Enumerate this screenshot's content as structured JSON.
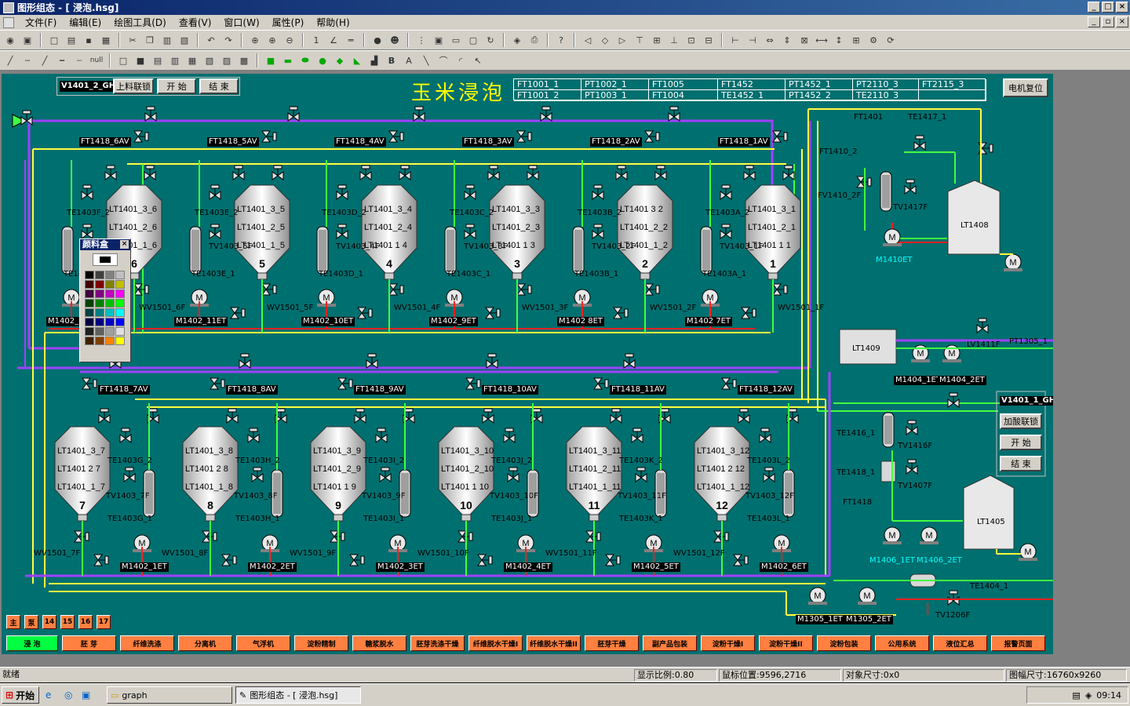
{
  "window": {
    "title": "图形组态 - [ 浸泡.hsg]"
  },
  "menu": [
    "文件(F)",
    "编辑(E)",
    "绘图工具(D)",
    "查看(V)",
    "窗口(W)",
    "属性(P)",
    "帮助(H)"
  ],
  "canvas": {
    "title": "玉米浸泡",
    "top_input": "V1401_2_GH",
    "top_buttons": [
      "上料联锁",
      "开 始",
      "结 束"
    ],
    "reset_button": "电机复位",
    "ft_table": [
      [
        "FT1001_1",
        "PT1002_1",
        "FT1005",
        "FT1452",
        "PT1452_1",
        "PT2110_3",
        "FT2115_3"
      ],
      [
        "FT1001_2",
        "PT1003_1",
        "FT1004",
        "TE1452_1",
        "PT1452_2",
        "TE2110_3",
        ""
      ]
    ],
    "tank_numbers_top": [
      "6",
      "5",
      "4",
      "3",
      "2",
      "1"
    ],
    "tank_numbers_bottom": [
      "7",
      "8",
      "9",
      "10",
      "11",
      "12"
    ],
    "tanks_top": [
      [
        "LT1401_3_6",
        "LT1401_2_6",
        "LT1401_1_6"
      ],
      [
        "LT1401_3_5",
        "LT1401_2_5",
        "LT1401_1_5"
      ],
      [
        "LT1401_3_4",
        "LT1401_2_4",
        "LT1401 1 4"
      ],
      [
        "LT1401_3_3",
        "LT1401_2_3",
        "LT1401 1 3"
      ],
      [
        "LT1401 3 2",
        "LT1401_2_2",
        "LT1401_1_2"
      ],
      [
        "LT1401_3_1",
        "LT1401_2_1",
        "LT1401 1 1"
      ]
    ],
    "tanks_bottom": [
      [
        "LT1401_3_7",
        "LT1401 2 7",
        "LT1401_1_7"
      ],
      [
        "LT1401_3_8",
        "LT1401 2 8",
        "LT1401_1_8"
      ],
      [
        "LT1401_3_9",
        "LT1401_2_9",
        "LT1401 1 9"
      ],
      [
        "LT1401_3_10",
        "LT1401_2_10",
        "LT1401 1 10"
      ],
      [
        "LT1401_3_11",
        "LT1401_2_11",
        "LT1401_1_11"
      ],
      [
        "LT1401_3_12",
        "LT1401 2 12",
        "LT1401_1_12"
      ]
    ],
    "ft_top": [
      "FT1418_6AV",
      "FT1418_5AV",
      "FT1418_4AV",
      "FT1418_3AV",
      "FT1418_2AV",
      "FT1418_1AV"
    ],
    "ft_bottom": [
      "FT1418_7AV",
      "FT1418_8AV",
      "FT1418_9AV",
      "FT1418_10AV",
      "FT1418_11AV",
      "FT1418_12AV"
    ],
    "te_top": [
      "TE1403F_2",
      "TE1403E_2",
      "TE1403D_2",
      "TE1403C_2",
      "TE1403B_2",
      "TE1403A_2"
    ],
    "te_top_low": [
      "TE1403F_1",
      "TE1403E_1",
      "TE1403D_1",
      "TE1403C_1",
      "TE1403B_1",
      "TE1403A_1"
    ],
    "tv_top": [
      "TV1403_6F",
      "TV1403_5F",
      "TV1403_4F",
      "TV1403_3F",
      "TV1403_2F",
      "TV1403_1F"
    ],
    "wv_top": [
      "WV1501_6F",
      "WV1501_5F",
      "WV1501_4F",
      "WV1501_3F",
      "WV1501_2F",
      "WV1501_1F"
    ],
    "m_top": [
      "M1402_12ET",
      "M1402_11ET",
      "M1402_10ET",
      "M1402_9ET",
      "M1402 8ET",
      "M1402 7ET"
    ],
    "te_bot": [
      "TE1403G_2",
      "TE1403H_2",
      "TE1403I_2",
      "TE1403J_2",
      "TE1403K_2",
      "TE1403L_2"
    ],
    "te_bot_low": [
      "TE1403G_1",
      "TE1403H_1",
      "TE1403I_1",
      "TE1403J_1",
      "TE1403K_1",
      "TE1403L_1"
    ],
    "tv_bot": [
      "TV1403_7F",
      "TV1403_8F",
      "TV1403_9F",
      "TV1403_10F",
      "TV1403_11F",
      "TV1403_12F"
    ],
    "wv_bot": [
      "WV1501_7F",
      "WV1501_8F",
      "WV1501_9F",
      "WV1501_10F",
      "WV1501_11F",
      "WV1501_12F"
    ],
    "m_bot": [
      "M1402_1ET",
      "M1402_2ET",
      "M1402_3ET",
      "M1402_4ET",
      "M1402_5ET",
      "M1402_6ET"
    ],
    "right": {
      "ft1401": "FT1401",
      "te1417": "TE1417_1",
      "ft1410": "FT1410_2",
      "fv1410": "FV1410_2F",
      "tv1417": "TV1417F",
      "lt1408": "LT1408",
      "m1410": "M1410ET",
      "lt1409": "LT1409",
      "lv1411": "LV1411F",
      "pt1305": "PT1305_1",
      "m1404_1": "M1404_1ET",
      "m1404_2": "M1404_2ET",
      "v1401_1": "V1401_1_GH",
      "acid_buttons": [
        "加酸联锁",
        "开 始",
        "结 束"
      ],
      "te1416": "TE1416_1",
      "tv1416": "TV1416F",
      "te1418": "TE1418_1",
      "tv1407": "TV1407F",
      "ft1418": "FT1418",
      "lt1405": "LT1405",
      "m1406_1": "M1406_1ET",
      "m1406_2": "M1406_2ET",
      "te1404": "TE1404_1",
      "m1305_1": "M1305_1ET",
      "m1305_2": "M1305_2ET",
      "tv1206": "TV1206F"
    },
    "palette_title": "颜料盒",
    "nav_small": [
      "主",
      "泵",
      "14",
      "15",
      "16",
      "17"
    ],
    "nav_pages": [
      "浸 泡",
      "胚 芽",
      "纤维洗涤",
      "分离机",
      "气浮机",
      "淀粉精制",
      "糖浆脱水",
      "胚芽洗涤干燥",
      "纤维脱水干燥I",
      "纤维脱水干燥II",
      "胚芽干燥",
      "副产品包装",
      "淀粉干燥I",
      "淀粉干燥II",
      "淀粉包装",
      "公用系统",
      "液位汇总",
      "报警页面"
    ]
  },
  "status": {
    "ready": "就绪",
    "scale": "显示比例:0.80",
    "mouse": "鼠标位置:9596,2716",
    "objsize": "对象尺寸:0x0",
    "pagesize": "图幅尺寸:16760x9260"
  },
  "taskbar": {
    "start": "开始",
    "items": [
      "graph",
      "图形组态 - [ 浸泡.hsg]"
    ],
    "clock": "09:14"
  },
  "colors": {
    "bg": "#006f6f",
    "pipe_purple": "#a040ff",
    "pipe_yellow": "#ffff40",
    "pipe_green": "#40ff40",
    "pipe_red": "#ff2020",
    "title": "#ffff00"
  }
}
